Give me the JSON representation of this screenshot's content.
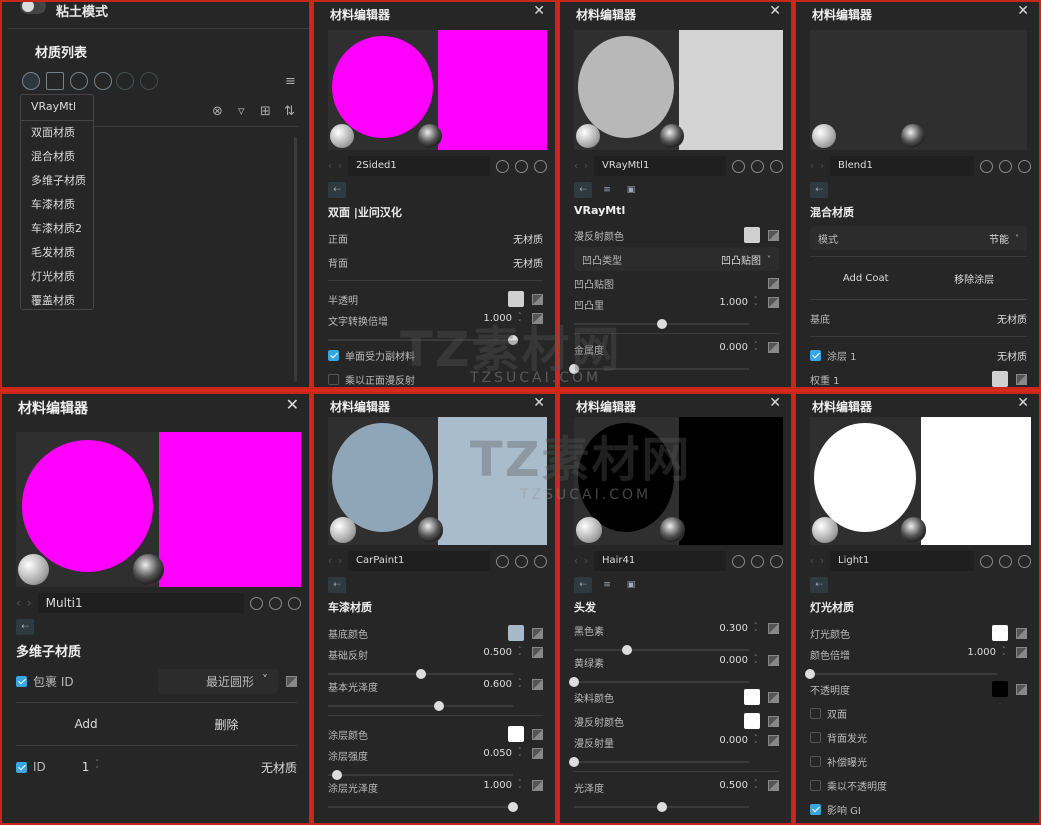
{
  "material_list_panel": {
    "clay_mode_label": "粘土模式",
    "title": "材质列表",
    "create_menu": [
      "VRayMtl",
      "双面材质",
      "混合材质",
      "多维子材质",
      "车漆材质",
      "车漆材质2",
      "毛发材质",
      "灯光材质",
      "覆盖材质"
    ]
  },
  "watermark": {
    "text": "TZ素材网",
    "url_text": "TZSUCAI.COM"
  },
  "panels": [
    {
      "title": "材料编辑器",
      "name": "2Sided1",
      "sphere": "#ff00ff",
      "square": "#ff00ff",
      "tabs": 1,
      "section": "双面 |业问汉化",
      "rows": [
        {
          "type": "link",
          "label": "正面",
          "value": "无材质"
        },
        {
          "type": "link",
          "label": "背面",
          "value": "无材质"
        },
        {
          "type": "divider"
        },
        {
          "type": "color",
          "label": "半透明",
          "color": "#d0d0d0"
        },
        {
          "type": "slider",
          "label": "文字转换倍增",
          "value": "1.000",
          "fraction": 1.0
        },
        {
          "type": "check",
          "label": "单面受力副材料",
          "checked": true
        },
        {
          "type": "check",
          "label": "乘以正面漫反射",
          "checked": false
        }
      ]
    },
    {
      "title": "材料编辑器",
      "name": "VRayMtl1",
      "sphere": "#b8b8b8",
      "square": "#d4d4d4",
      "tabs": 3,
      "section": "VRayMtl",
      "rows": [
        {
          "type": "color",
          "label": "漫反射颜色",
          "color": "#d0d0d0"
        },
        {
          "type": "dropdown",
          "label": "凹凸类型",
          "value": "凹凸贴图"
        },
        {
          "type": "map",
          "label": "凹凸贴图"
        },
        {
          "type": "slider",
          "label": "凹凸里",
          "value": "1.000",
          "fraction": 0.5
        },
        {
          "type": "divider"
        },
        {
          "type": "slider",
          "label": "金属度",
          "value": "0.000",
          "fraction": 0.0
        }
      ]
    },
    {
      "title": "材料编辑器",
      "name": "Blend1",
      "sphere": "",
      "square": "",
      "tabs": 1,
      "section": "混合材质",
      "rows": [
        {
          "type": "dropdown",
          "label": "模式",
          "value": "节能"
        },
        {
          "type": "divider"
        },
        {
          "type": "buttons",
          "a": "Add Coat",
          "b": "移除涂层"
        },
        {
          "type": "divider"
        },
        {
          "type": "link",
          "label": "基底",
          "value": "无材质"
        },
        {
          "type": "divider"
        },
        {
          "type": "checklink",
          "label": "涂层 1",
          "value": "无材质",
          "checked": true
        },
        {
          "type": "color",
          "label": "权重 1",
          "color": "#d0d0d0"
        }
      ]
    },
    {
      "title": "材料编辑器",
      "name": "Multi1",
      "sphere": "#ff00ff",
      "square": "#ff00ff",
      "tabs": 1,
      "section": "多维子材质",
      "rows": [
        {
          "type": "checkdd",
          "label": "包裹 ID",
          "value": "最近圆形",
          "checked": true
        },
        {
          "type": "divider"
        },
        {
          "type": "buttons",
          "a": "Add",
          "b": "删除"
        },
        {
          "type": "divider"
        },
        {
          "type": "idrow",
          "label": "ID",
          "num": "1",
          "value": "无材质",
          "checked": true
        }
      ]
    },
    {
      "title": "材料编辑器",
      "name": "CarPaint1",
      "sphere": "#8fa6b8",
      "square": "#a8bccb",
      "tabs": 1,
      "section": "车漆材质",
      "rows": [
        {
          "type": "color",
          "label": "基底颜色",
          "color": "#a7b8c8"
        },
        {
          "type": "slider",
          "label": "基础反射",
          "value": "0.500",
          "fraction": 0.5
        },
        {
          "type": "slider",
          "label": "基本光泽度",
          "value": "0.600",
          "fraction": 0.6
        },
        {
          "type": "divider"
        },
        {
          "type": "color",
          "label": "涂层颜色",
          "color": "#ffffff"
        },
        {
          "type": "slider",
          "label": "涂层强度",
          "value": "0.050",
          "fraction": 0.05
        },
        {
          "type": "slider",
          "label": "涂层光泽度",
          "value": "1.000",
          "fraction": 1.0
        }
      ]
    },
    {
      "title": "材料编辑器",
      "name": "Hair41",
      "sphere": "#000000",
      "square": "#000000",
      "tabs": 3,
      "section": "头发",
      "rows": [
        {
          "type": "slider",
          "label": "黑色素",
          "value": "0.300",
          "fraction": 0.3
        },
        {
          "type": "slider",
          "label": "黄绿素",
          "value": "0.000",
          "fraction": 0.0
        },
        {
          "type": "color",
          "label": "染料颜色",
          "color": "#ffffff"
        },
        {
          "type": "color",
          "label": "漫反射颜色",
          "color": "#ffffff"
        },
        {
          "type": "slider",
          "label": "漫反射量",
          "value": "0.000",
          "fraction": 0.0
        },
        {
          "type": "divider"
        },
        {
          "type": "slider",
          "label": "光泽度",
          "value": "0.500",
          "fraction": 0.5
        }
      ]
    },
    {
      "title": "材料编辑器",
      "name": "Light1",
      "sphere": "#ffffff",
      "square": "#ffffff",
      "tabs": 1,
      "section": "灯光材质",
      "rows": [
        {
          "type": "color",
          "label": "灯光颜色",
          "color": "#ffffff"
        },
        {
          "type": "slider",
          "label": "颜色倍增",
          "value": "1.000",
          "fraction": 0.0
        },
        {
          "type": "color",
          "label": "不透明度",
          "color": "#000000"
        },
        {
          "type": "check",
          "label": "双面",
          "checked": false
        },
        {
          "type": "check",
          "label": "背面发光",
          "checked": false
        },
        {
          "type": "check",
          "label": "补偿曝光",
          "checked": false
        },
        {
          "type": "check",
          "label": "乘以不透明度",
          "checked": false
        },
        {
          "type": "check",
          "label": "影响 GI",
          "checked": true
        }
      ]
    }
  ]
}
